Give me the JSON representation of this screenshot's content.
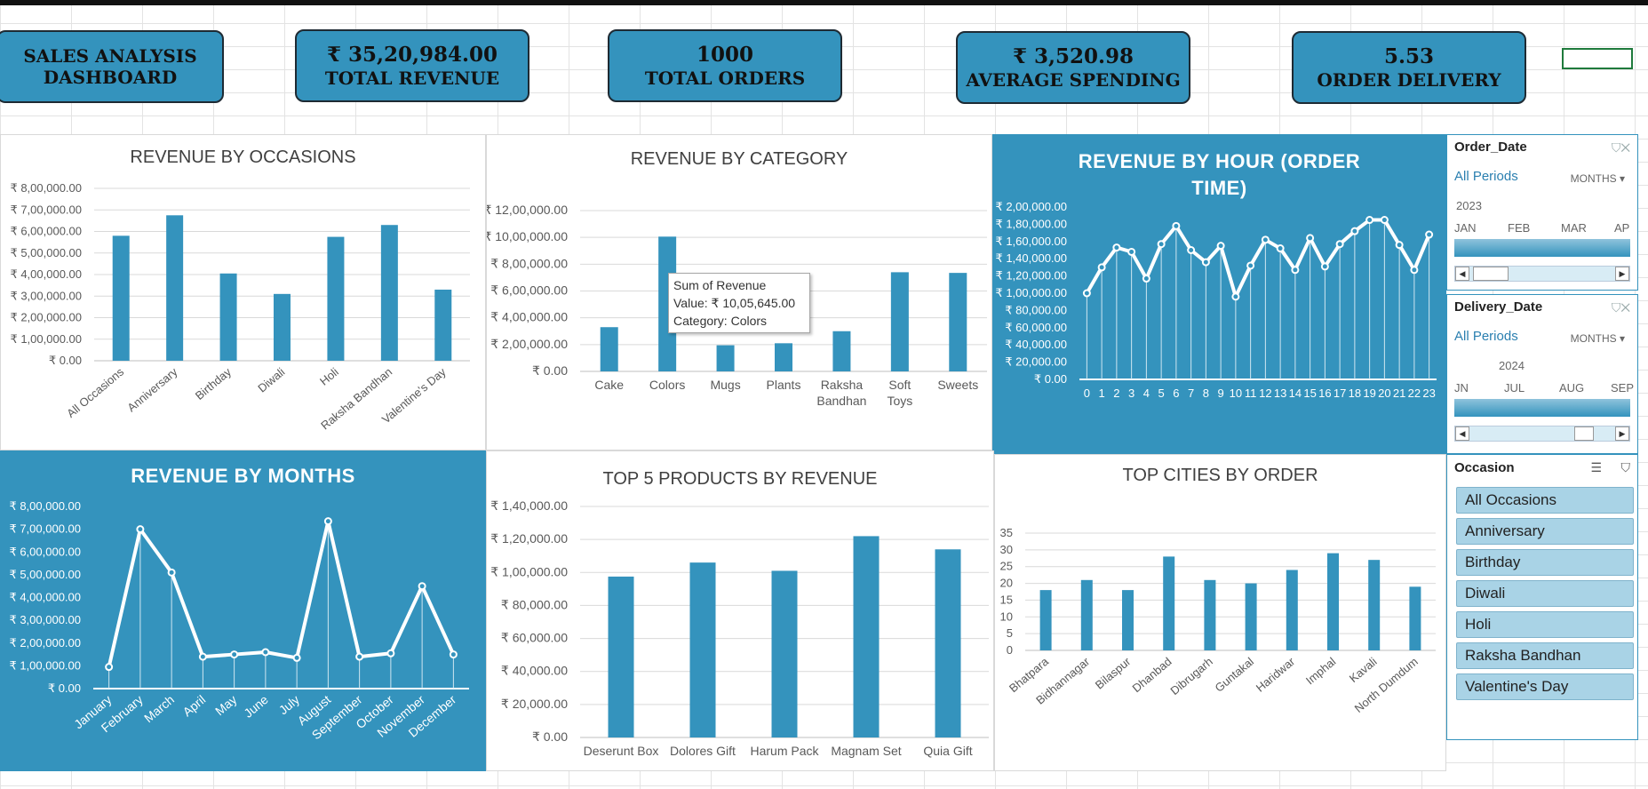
{
  "kpis": {
    "title": {
      "line1": "SALES ANALYSIS",
      "line2": "DASHBOARD"
    },
    "revenue": {
      "value": "₹ 35,20,984.00",
      "label": "TOTAL REVENUE"
    },
    "orders": {
      "value": "1000",
      "label": "TOTAL ORDERS"
    },
    "spending": {
      "value": "₹ 3,520.98",
      "label": "AVERAGE SPENDING"
    },
    "delivery": {
      "value": "5.53",
      "label": "ORDER DELIVERY"
    }
  },
  "colors": {
    "accent": "#3493bd",
    "white": "#ffffff",
    "axis_text": "#595959"
  },
  "chart_data": [
    {
      "id": "occasions",
      "type": "bar",
      "title": "REVENUE BY OCCASIONS",
      "categories": [
        "All Occasions",
        "Anniversary",
        "Birthday",
        "Diwali",
        "Holi",
        "Raksha Bandhan",
        "Valentine's Day"
      ],
      "values": [
        580000,
        675000,
        405000,
        310000,
        575000,
        630000,
        330000
      ],
      "ylim": [
        0,
        800000
      ],
      "yticks": [
        "₹ 0.00",
        "₹ 1,00,000.00",
        "₹ 2,00,000.00",
        "₹ 3,00,000.00",
        "₹ 4,00,000.00",
        "₹ 5,00,000.00",
        "₹ 6,00,000.00",
        "₹ 7,00,000.00",
        "₹ 8,00,000.00"
      ]
    },
    {
      "id": "category",
      "type": "bar",
      "title": "REVENUE BY CATEGORY",
      "categories": [
        "Cake",
        "Colors",
        "Mugs",
        "Plants",
        "Raksha Bandhan",
        "Soft Toys",
        "Sweets"
      ],
      "values": [
        330000,
        1005645,
        195000,
        210000,
        300000,
        740000,
        735000
      ],
      "ylim": [
        0,
        1200000
      ],
      "yticks": [
        "₹ 0.00",
        "₹ 2,00,000.00",
        "₹ 4,00,000.00",
        "₹ 6,00,000.00",
        "₹ 8,00,000.00",
        "₹ 10,00,000.00",
        "₹ 12,00,000.00"
      ],
      "tooltip": {
        "line1": "Sum of Revenue",
        "line2": "Value: ₹ 10,05,645.00",
        "line3": "Category: Colors"
      }
    },
    {
      "id": "hour",
      "type": "line",
      "title": "REVENUE BY HOUR (ORDER TIME)",
      "categories": [
        "0",
        "1",
        "2",
        "3",
        "4",
        "5",
        "6",
        "7",
        "8",
        "9",
        "10",
        "11",
        "12",
        "13",
        "14",
        "15",
        "16",
        "17",
        "18",
        "19",
        "20",
        "21",
        "22",
        "23"
      ],
      "values": [
        100000,
        130000,
        153000,
        148000,
        117000,
        157000,
        178000,
        150000,
        136000,
        155000,
        96000,
        132000,
        162000,
        152000,
        127000,
        164000,
        131000,
        157000,
        172000,
        185000,
        185000,
        156000,
        127000,
        168000
      ],
      "ylim": [
        0,
        200000
      ],
      "yticks": [
        "₹ 0.00",
        "₹ 20,000.00",
        "₹ 40,000.00",
        "₹ 60,000.00",
        "₹ 80,000.00",
        "₹ 1,00,000.00",
        "₹ 1,20,000.00",
        "₹ 1,40,000.00",
        "₹ 1,60,000.00",
        "₹ 1,80,000.00",
        "₹ 2,00,000.00"
      ]
    },
    {
      "id": "months",
      "type": "line",
      "title": "REVENUE BY MONTHS",
      "categories": [
        "January",
        "February",
        "March",
        "April",
        "May",
        "June",
        "July",
        "August",
        "September",
        "October",
        "November",
        "December"
      ],
      "values": [
        95000,
        700000,
        510000,
        140000,
        150000,
        160000,
        135000,
        735000,
        140000,
        155000,
        450000,
        150000
      ],
      "ylim": [
        0,
        800000
      ],
      "yticks": [
        "₹ 0.00",
        "₹ 1,00,000.00",
        "₹ 2,00,000.00",
        "₹ 3,00,000.00",
        "₹ 4,00,000.00",
        "₹ 5,00,000.00",
        "₹ 6,00,000.00",
        "₹ 7,00,000.00",
        "₹ 8,00,000.00"
      ]
    },
    {
      "id": "products",
      "type": "bar",
      "title": "TOP 5 PRODUCTS BY REVENUE",
      "categories": [
        "Deserunt Box",
        "Dolores Gift",
        "Harum Pack",
        "Magnam Set",
        "Quia Gift"
      ],
      "values": [
        97500,
        106000,
        101000,
        122000,
        114000
      ],
      "ylim": [
        0,
        140000
      ],
      "yticks": [
        "₹ 0.00",
        "₹ 20,000.00",
        "₹ 40,000.00",
        "₹ 60,000.00",
        "₹ 80,000.00",
        "₹ 1,00,000.00",
        "₹ 1,20,000.00",
        "₹ 1,40,000.00"
      ]
    },
    {
      "id": "cities",
      "type": "bar",
      "title": "TOP CITIES BY ORDER",
      "categories": [
        "Bhatpara",
        "Bidhannagar",
        "Bilaspur",
        "Dhanbad",
        "Dibrugarh",
        "Guntakal",
        "Haridwar",
        "Imphal",
        "Kavali",
        "North Dumdum"
      ],
      "values": [
        18,
        21,
        18,
        28,
        21,
        20,
        24,
        29,
        27,
        19
      ],
      "ylim": [
        0,
        35
      ],
      "yticks": [
        "0",
        "5",
        "10",
        "15",
        "20",
        "25",
        "30",
        "35"
      ]
    }
  ],
  "slicers": {
    "order_date": {
      "title": "Order_Date",
      "periods": "All Periods",
      "unit": "MONTHS",
      "year": "2023",
      "months": [
        "JAN",
        "FEB",
        "MAR",
        "AP"
      ]
    },
    "delivery_date": {
      "title": "Delivery_Date",
      "periods": "All Periods",
      "unit": "MONTHS",
      "year": "2024",
      "months": [
        "JN",
        "JUL",
        "AUG",
        "SEP"
      ]
    },
    "occasion": {
      "title": "Occasion",
      "items": [
        "All Occasions",
        "Anniversary",
        "Birthday",
        "Diwali",
        "Holi",
        "Raksha Bandhan",
        "Valentine's Day"
      ]
    }
  }
}
